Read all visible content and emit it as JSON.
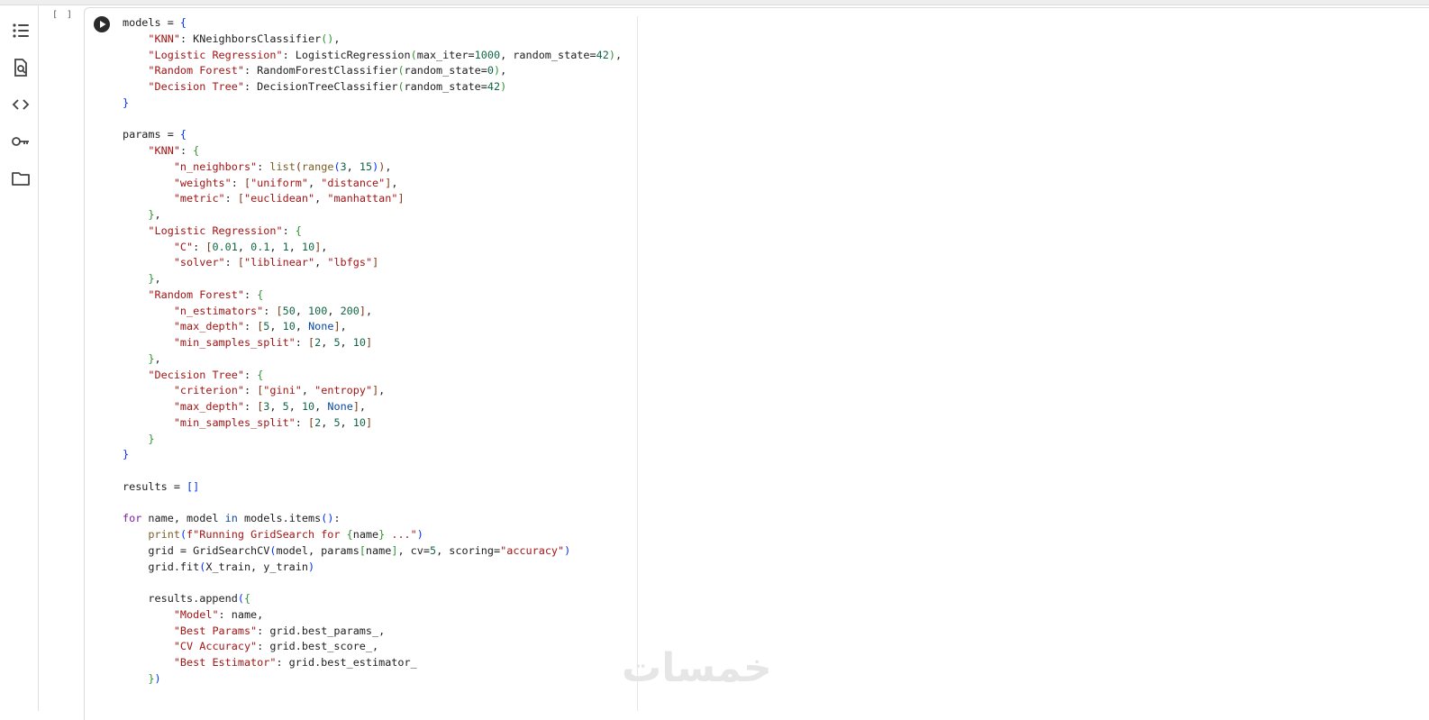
{
  "execution_count": "[ ]",
  "watermark_text": "خمسات",
  "sidebar": {
    "items": [
      {
        "name": "table-of-contents-icon"
      },
      {
        "name": "find-icon"
      },
      {
        "name": "code-snippets-icon"
      },
      {
        "name": "secrets-key-icon"
      },
      {
        "name": "files-folder-icon"
      }
    ]
  },
  "code_lines": [
    [
      {
        "t": "models = "
      },
      {
        "t": "{",
        "c": "b1"
      }
    ],
    [
      {
        "t": "    "
      },
      {
        "t": "\"KNN\"",
        "c": "s"
      },
      {
        "t": ": KNeighborsClassifier"
      },
      {
        "t": "()",
        "c": "b2"
      },
      {
        "t": ","
      }
    ],
    [
      {
        "t": "    "
      },
      {
        "t": "\"Logistic Regression\"",
        "c": "s"
      },
      {
        "t": ": LogisticRegression"
      },
      {
        "t": "(",
        "c": "b2"
      },
      {
        "t": "max_iter="
      },
      {
        "t": "1000",
        "c": "n"
      },
      {
        "t": ", random_state="
      },
      {
        "t": "42",
        "c": "n"
      },
      {
        "t": ")",
        "c": "b2"
      },
      {
        "t": ","
      }
    ],
    [
      {
        "t": "    "
      },
      {
        "t": "\"Random Forest\"",
        "c": "s"
      },
      {
        "t": ": RandomForestClassifier"
      },
      {
        "t": "(",
        "c": "b2"
      },
      {
        "t": "random_state="
      },
      {
        "t": "0",
        "c": "n"
      },
      {
        "t": ")",
        "c": "b2"
      },
      {
        "t": ","
      }
    ],
    [
      {
        "t": "    "
      },
      {
        "t": "\"Decision Tree\"",
        "c": "s"
      },
      {
        "t": ": DecisionTreeClassifier"
      },
      {
        "t": "(",
        "c": "b2"
      },
      {
        "t": "random_state="
      },
      {
        "t": "42",
        "c": "n"
      },
      {
        "t": ")",
        "c": "b2"
      }
    ],
    [
      {
        "t": "}",
        "c": "b1"
      }
    ],
    [
      {
        "t": ""
      }
    ],
    [
      {
        "t": "params = "
      },
      {
        "t": "{",
        "c": "b1"
      }
    ],
    [
      {
        "t": "    "
      },
      {
        "t": "\"KNN\"",
        "c": "s"
      },
      {
        "t": ": "
      },
      {
        "t": "{",
        "c": "b2"
      }
    ],
    [
      {
        "t": "        "
      },
      {
        "t": "\"n_neighbors\"",
        "c": "s"
      },
      {
        "t": ": "
      },
      {
        "t": "list",
        "c": "f"
      },
      {
        "t": "(",
        "c": "b3"
      },
      {
        "t": "range",
        "c": "f"
      },
      {
        "t": "(",
        "c": "b1"
      },
      {
        "t": "3",
        "c": "n"
      },
      {
        "t": ", "
      },
      {
        "t": "15",
        "c": "n"
      },
      {
        "t": ")",
        "c": "b1"
      },
      {
        "t": ")",
        "c": "b3"
      },
      {
        "t": ","
      }
    ],
    [
      {
        "t": "        "
      },
      {
        "t": "\"weights\"",
        "c": "s"
      },
      {
        "t": ": "
      },
      {
        "t": "[",
        "c": "b3"
      },
      {
        "t": "\"uniform\"",
        "c": "s"
      },
      {
        "t": ", "
      },
      {
        "t": "\"distance\"",
        "c": "s"
      },
      {
        "t": "]",
        "c": "b3"
      },
      {
        "t": ","
      }
    ],
    [
      {
        "t": "        "
      },
      {
        "t": "\"metric\"",
        "c": "s"
      },
      {
        "t": ": "
      },
      {
        "t": "[",
        "c": "b3"
      },
      {
        "t": "\"euclidean\"",
        "c": "s"
      },
      {
        "t": ", "
      },
      {
        "t": "\"manhattan\"",
        "c": "s"
      },
      {
        "t": "]",
        "c": "b3"
      }
    ],
    [
      {
        "t": "    "
      },
      {
        "t": "}",
        "c": "b2"
      },
      {
        "t": ","
      }
    ],
    [
      {
        "t": "    "
      },
      {
        "t": "\"Logistic Regression\"",
        "c": "s"
      },
      {
        "t": ": "
      },
      {
        "t": "{",
        "c": "b2"
      }
    ],
    [
      {
        "t": "        "
      },
      {
        "t": "\"C\"",
        "c": "s"
      },
      {
        "t": ": "
      },
      {
        "t": "[",
        "c": "b3"
      },
      {
        "t": "0.01",
        "c": "n"
      },
      {
        "t": ", "
      },
      {
        "t": "0.1",
        "c": "n"
      },
      {
        "t": ", "
      },
      {
        "t": "1",
        "c": "n"
      },
      {
        "t": ", "
      },
      {
        "t": "10",
        "c": "n"
      },
      {
        "t": "]",
        "c": "b3"
      },
      {
        "t": ","
      }
    ],
    [
      {
        "t": "        "
      },
      {
        "t": "\"solver\"",
        "c": "s"
      },
      {
        "t": ": "
      },
      {
        "t": "[",
        "c": "b3"
      },
      {
        "t": "\"liblinear\"",
        "c": "s"
      },
      {
        "t": ", "
      },
      {
        "t": "\"lbfgs\"",
        "c": "s"
      },
      {
        "t": "]",
        "c": "b3"
      }
    ],
    [
      {
        "t": "    "
      },
      {
        "t": "}",
        "c": "b2"
      },
      {
        "t": ","
      }
    ],
    [
      {
        "t": "    "
      },
      {
        "t": "\"Random Forest\"",
        "c": "s"
      },
      {
        "t": ": "
      },
      {
        "t": "{",
        "c": "b2"
      }
    ],
    [
      {
        "t": "        "
      },
      {
        "t": "\"n_estimators\"",
        "c": "s"
      },
      {
        "t": ": "
      },
      {
        "t": "[",
        "c": "b3"
      },
      {
        "t": "50",
        "c": "n"
      },
      {
        "t": ", "
      },
      {
        "t": "100",
        "c": "n"
      },
      {
        "t": ", "
      },
      {
        "t": "200",
        "c": "n"
      },
      {
        "t": "]",
        "c": "b3"
      },
      {
        "t": ","
      }
    ],
    [
      {
        "t": "        "
      },
      {
        "t": "\"max_depth\"",
        "c": "s"
      },
      {
        "t": ": "
      },
      {
        "t": "[",
        "c": "b3"
      },
      {
        "t": "5",
        "c": "n"
      },
      {
        "t": ", "
      },
      {
        "t": "10",
        "c": "n"
      },
      {
        "t": ", "
      },
      {
        "t": "None",
        "c": "kb"
      },
      {
        "t": "]",
        "c": "b3"
      },
      {
        "t": ","
      }
    ],
    [
      {
        "t": "        "
      },
      {
        "t": "\"min_samples_split\"",
        "c": "s"
      },
      {
        "t": ": "
      },
      {
        "t": "[",
        "c": "b3"
      },
      {
        "t": "2",
        "c": "n"
      },
      {
        "t": ", "
      },
      {
        "t": "5",
        "c": "n"
      },
      {
        "t": ", "
      },
      {
        "t": "10",
        "c": "n"
      },
      {
        "t": "]",
        "c": "b3"
      }
    ],
    [
      {
        "t": "    "
      },
      {
        "t": "}",
        "c": "b2"
      },
      {
        "t": ","
      }
    ],
    [
      {
        "t": "    "
      },
      {
        "t": "\"Decision Tree\"",
        "c": "s"
      },
      {
        "t": ": "
      },
      {
        "t": "{",
        "c": "b2"
      }
    ],
    [
      {
        "t": "        "
      },
      {
        "t": "\"criterion\"",
        "c": "s"
      },
      {
        "t": ": "
      },
      {
        "t": "[",
        "c": "b3"
      },
      {
        "t": "\"gini\"",
        "c": "s"
      },
      {
        "t": ", "
      },
      {
        "t": "\"entropy\"",
        "c": "s"
      },
      {
        "t": "]",
        "c": "b3"
      },
      {
        "t": ","
      }
    ],
    [
      {
        "t": "        "
      },
      {
        "t": "\"max_depth\"",
        "c": "s"
      },
      {
        "t": ": "
      },
      {
        "t": "[",
        "c": "b3"
      },
      {
        "t": "3",
        "c": "n"
      },
      {
        "t": ", "
      },
      {
        "t": "5",
        "c": "n"
      },
      {
        "t": ", "
      },
      {
        "t": "10",
        "c": "n"
      },
      {
        "t": ", "
      },
      {
        "t": "None",
        "c": "kb"
      },
      {
        "t": "]",
        "c": "b3"
      },
      {
        "t": ","
      }
    ],
    [
      {
        "t": "        "
      },
      {
        "t": "\"min_samples_split\"",
        "c": "s"
      },
      {
        "t": ": "
      },
      {
        "t": "[",
        "c": "b3"
      },
      {
        "t": "2",
        "c": "n"
      },
      {
        "t": ", "
      },
      {
        "t": "5",
        "c": "n"
      },
      {
        "t": ", "
      },
      {
        "t": "10",
        "c": "n"
      },
      {
        "t": "]",
        "c": "b3"
      }
    ],
    [
      {
        "t": "    "
      },
      {
        "t": "}",
        "c": "b2"
      }
    ],
    [
      {
        "t": "}",
        "c": "b1"
      }
    ],
    [
      {
        "t": ""
      }
    ],
    [
      {
        "t": "results = "
      },
      {
        "t": "[]",
        "c": "b1"
      }
    ],
    [
      {
        "t": ""
      }
    ],
    [
      {
        "t": "for",
        "c": "k"
      },
      {
        "t": " name, model "
      },
      {
        "t": "in",
        "c": "kb"
      },
      {
        "t": " models.items"
      },
      {
        "t": "()",
        "c": "b1"
      },
      {
        "t": ":"
      }
    ],
    [
      {
        "t": "    "
      },
      {
        "t": "print",
        "c": "f"
      },
      {
        "t": "(",
        "c": "b1"
      },
      {
        "t": "f\"Running GridSearch for ",
        "c": "s"
      },
      {
        "t": "{",
        "c": "b2"
      },
      {
        "t": "name"
      },
      {
        "t": "}",
        "c": "b2"
      },
      {
        "t": " ...\"",
        "c": "s"
      },
      {
        "t": ")",
        "c": "b1"
      }
    ],
    [
      {
        "t": "    grid = GridSearchCV"
      },
      {
        "t": "(",
        "c": "b1"
      },
      {
        "t": "model, params"
      },
      {
        "t": "[",
        "c": "b2"
      },
      {
        "t": "name"
      },
      {
        "t": "]",
        "c": "b2"
      },
      {
        "t": ", cv="
      },
      {
        "t": "5",
        "c": "n"
      },
      {
        "t": ", scoring="
      },
      {
        "t": "\"accuracy\"",
        "c": "s"
      },
      {
        "t": ")",
        "c": "b1"
      }
    ],
    [
      {
        "t": "    grid.fit"
      },
      {
        "t": "(",
        "c": "b1"
      },
      {
        "t": "X_train, y_train"
      },
      {
        "t": ")",
        "c": "b1"
      }
    ],
    [
      {
        "t": ""
      }
    ],
    [
      {
        "t": "    results.append"
      },
      {
        "t": "(",
        "c": "b1"
      },
      {
        "t": "{",
        "c": "b2"
      }
    ],
    [
      {
        "t": "        "
      },
      {
        "t": "\"Model\"",
        "c": "s"
      },
      {
        "t": ": name,"
      }
    ],
    [
      {
        "t": "        "
      },
      {
        "t": "\"Best Params\"",
        "c": "s"
      },
      {
        "t": ": grid.best_params_,"
      }
    ],
    [
      {
        "t": "        "
      },
      {
        "t": "\"CV Accuracy\"",
        "c": "s"
      },
      {
        "t": ": grid.best_score_,"
      }
    ],
    [
      {
        "t": "        "
      },
      {
        "t": "\"Best Estimator\"",
        "c": "s"
      },
      {
        "t": ": grid.best_estimator_"
      }
    ],
    [
      {
        "t": "    "
      },
      {
        "t": "}",
        "c": "b2"
      },
      {
        "t": ")",
        "c": "b1"
      }
    ]
  ]
}
